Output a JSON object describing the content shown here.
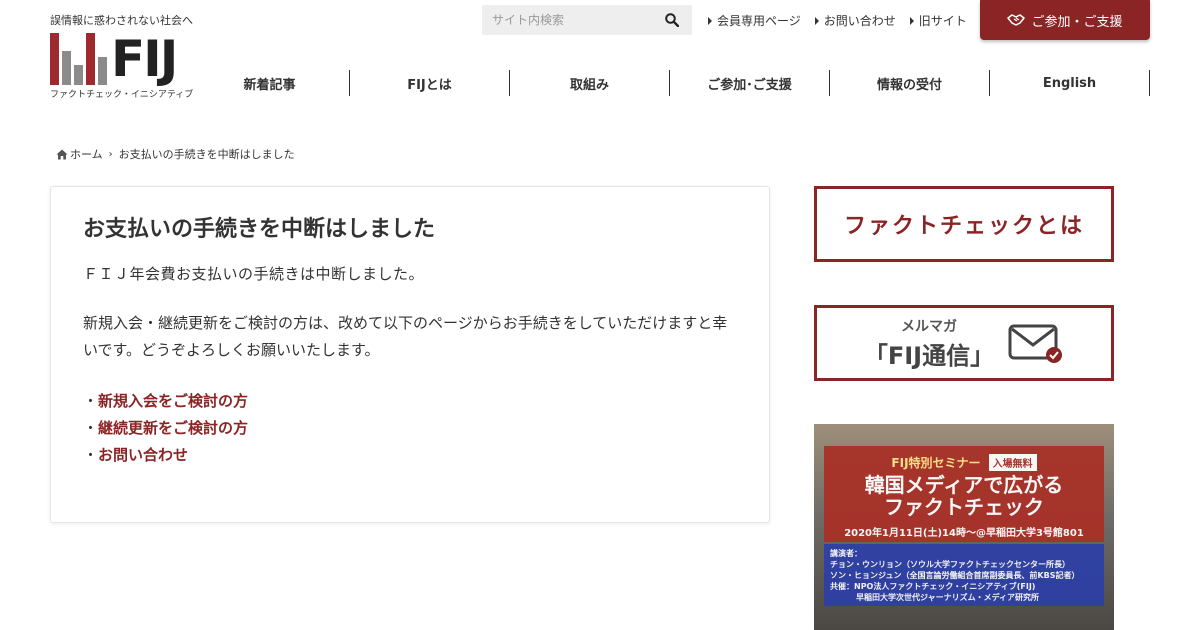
{
  "header": {
    "tagline": "誤情報に惑わされない社会へ",
    "logo_text": "FIJ",
    "logo_sub": "ファクトチェック・イニシアティブ",
    "search": {
      "placeholder": "サイト内検索"
    },
    "top_links": [
      {
        "label": "会員専用ページ"
      },
      {
        "label": "お問い合わせ"
      },
      {
        "label": "旧サイト"
      }
    ],
    "join_button": "ご参加・ご支援",
    "nav": [
      {
        "label": "新着記事"
      },
      {
        "label": "FIJとは"
      },
      {
        "label": "取組み"
      },
      {
        "label": "ご参加･ご支援"
      },
      {
        "label": "情報の受付"
      },
      {
        "label": "English"
      }
    ]
  },
  "breadcrumb": {
    "home": "ホーム",
    "current": "お支払いの手続きを中断はしました"
  },
  "main": {
    "title": "お支払いの手続きを中断はしました",
    "paragraph1": "ＦＩＪ年会費お支払いの手続きは中断しました。",
    "paragraph2": "新規入会・継続更新をご検討の方は、改めて以下のページからお手続きをしていただけますと幸いです。どうぞよろしくお願いいたします。",
    "links": [
      {
        "bullet": "・",
        "label": "新規入会をご検討の方"
      },
      {
        "bullet": "・",
        "label": "継続更新をご検討の方"
      },
      {
        "bullet": "・",
        "label": "お問い合わせ"
      }
    ]
  },
  "sidebar": {
    "banner1": "ファクトチェックとは",
    "banner2_small": "メルマガ",
    "banner2_big": "「FIJ通信」",
    "seminar": {
      "label": "FIJ特別セミナー",
      "badge": "入場無料",
      "title_line1": "韓国メディアで広がる",
      "title_line2": "ファクトチェック",
      "date": "2020年1月11日(土)14時〜@早稲田大学3号館801",
      "speakers_label": "講演者：",
      "speaker1": "チョン・ウンリョン（ソウル大学ファクトチェックセンター所長）",
      "speaker2": "ソン・ヒョンジュン（全国言論労働組合首席副委員長、前KBS記者）",
      "host1": "共催：NPO法人ファクトチェック・イニシアティブ(FIJ)",
      "host2": "早稲田大学次世代ジャーナリズム・メディア研究所"
    }
  },
  "colors": {
    "accent": "#8b2525",
    "nav_text": "#333333",
    "seminar_red": "#a83128",
    "seminar_blue": "#2c3fa8"
  }
}
